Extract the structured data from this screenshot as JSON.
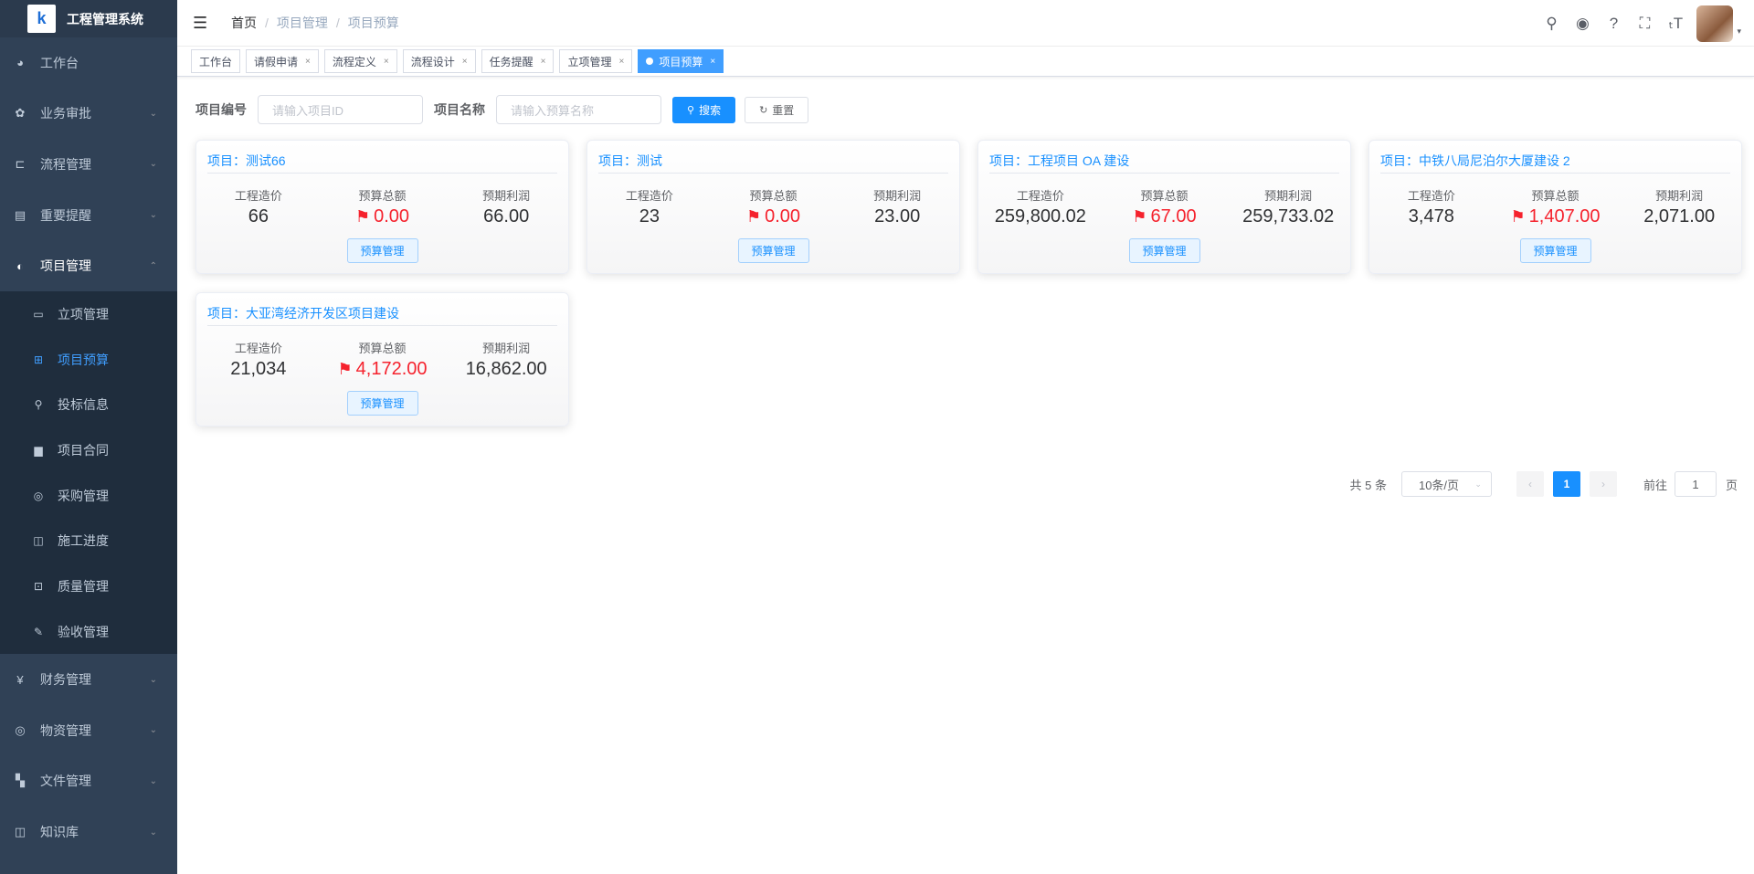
{
  "app": {
    "title": "工程管理系统",
    "logo_glyph": "k"
  },
  "sidebar": {
    "items": [
      {
        "icon": "dashboard-icon",
        "glyph": "◕",
        "label": "工作台"
      },
      {
        "icon": "approval-icon",
        "glyph": "✿",
        "label": "业务审批",
        "chevron": "⌄"
      },
      {
        "icon": "flow-icon",
        "glyph": "⊏",
        "label": "流程管理",
        "chevron": "⌄"
      },
      {
        "icon": "calendar-icon",
        "glyph": "▤",
        "label": "重要提醒",
        "chevron": "⌄"
      },
      {
        "icon": "globe-icon",
        "glyph": "◐",
        "label": "项目管理",
        "chevron": "⌃"
      }
    ],
    "sub_items": [
      {
        "icon": "monitor-icon",
        "glyph": "▭",
        "label": "立项管理"
      },
      {
        "icon": "table-icon",
        "glyph": "⊞",
        "label": "项目预算"
      },
      {
        "icon": "bid-icon",
        "glyph": "⚲",
        "label": "投标信息"
      },
      {
        "icon": "contract-icon",
        "glyph": "▆",
        "label": "项目合同"
      },
      {
        "icon": "purchase-icon",
        "glyph": "◎",
        "label": "采购管理"
      },
      {
        "icon": "progress-icon",
        "glyph": "◫",
        "label": "施工进度"
      },
      {
        "icon": "quality-icon",
        "glyph": "⊡",
        "label": "质量管理"
      },
      {
        "icon": "acceptance-icon",
        "glyph": "✎",
        "label": "验收管理"
      }
    ],
    "items_after": [
      {
        "icon": "yen-icon",
        "glyph": "¥",
        "label": "财务管理",
        "chevron": "⌄"
      },
      {
        "icon": "material-icon",
        "glyph": "◎",
        "label": "物资管理",
        "chevron": "⌄"
      },
      {
        "icon": "file-icon",
        "glyph": "▚",
        "label": "文件管理",
        "chevron": "⌄"
      },
      {
        "icon": "book-icon",
        "glyph": "◫",
        "label": "知识库",
        "chevron": "⌄"
      }
    ]
  },
  "navbar": {
    "hamburger_glyph": "☰",
    "breadcrumb": [
      "首页",
      "项目管理",
      "项目预算"
    ],
    "breadcrumb_sep": "/",
    "icons": [
      {
        "name": "search-icon",
        "glyph": "⚲"
      },
      {
        "name": "github-icon",
        "glyph": "◉"
      },
      {
        "name": "help-icon",
        "glyph": "?"
      },
      {
        "name": "fullscreen-icon",
        "glyph": "⛶"
      },
      {
        "name": "font-size-icon",
        "glyph": "ₜT"
      }
    ],
    "caret": "▾"
  },
  "tags": [
    {
      "label": "工作台"
    },
    {
      "label": "请假申请",
      "close": "×"
    },
    {
      "label": "流程定义",
      "close": "×"
    },
    {
      "label": "流程设计",
      "close": "×"
    },
    {
      "label": "任务提醒",
      "close": "×"
    },
    {
      "label": "立项管理",
      "close": "×"
    },
    {
      "label": "项目预算",
      "close": "×",
      "active": true
    }
  ],
  "search": {
    "code_label": "项目编号",
    "code_placeholder": "请输入项目ID",
    "name_label": "项目名称",
    "name_placeholder": "请输入预算名称",
    "search_button": "搜索",
    "reset_button": "重置",
    "search_icon": "⚲",
    "reset_icon": "↻"
  },
  "cards": [
    {
      "title": "项目：测试66",
      "cost_label": "工程造价",
      "cost": "66",
      "budget_label": "预算总额",
      "budget": "0.00",
      "profit_label": "预期利润",
      "profit": "66.00",
      "button": "预算管理"
    },
    {
      "title": "项目：测试",
      "cost_label": "工程造价",
      "cost": "23",
      "budget_label": "预算总额",
      "budget": "0.00",
      "profit_label": "预期利润",
      "profit": "23.00",
      "button": "预算管理"
    },
    {
      "title": "项目：工程项目 OA 建设",
      "cost_label": "工程造价",
      "cost": "259,800.02",
      "budget_label": "预算总额",
      "budget": "67.00",
      "profit_label": "预期利润",
      "profit": "259,733.02",
      "button": "预算管理"
    },
    {
      "title": "项目：中铁八局尼泊尔大厦建设 2",
      "cost_label": "工程造价",
      "cost": "3,478",
      "budget_label": "预算总额",
      "budget": "1,407.00",
      "profit_label": "预期利润",
      "profit": "2,071.00",
      "button": "预算管理"
    },
    {
      "title": "项目：大亚湾经济开发区项目建设",
      "cost_label": "工程造价",
      "cost": "21,034",
      "budget_label": "预算总额",
      "budget": "4,172.00",
      "profit_label": "预期利润",
      "profit": "16,862.00",
      "button": "预算管理"
    }
  ],
  "flag_glyph": "⚑",
  "pagination": {
    "total": "共 5 条",
    "page_size": "10条/页",
    "size_chevron": "⌄",
    "prev": "‹",
    "current": "1",
    "next": "›",
    "goto_prefix": "前往",
    "goto_value": "1",
    "goto_suffix": "页"
  }
}
